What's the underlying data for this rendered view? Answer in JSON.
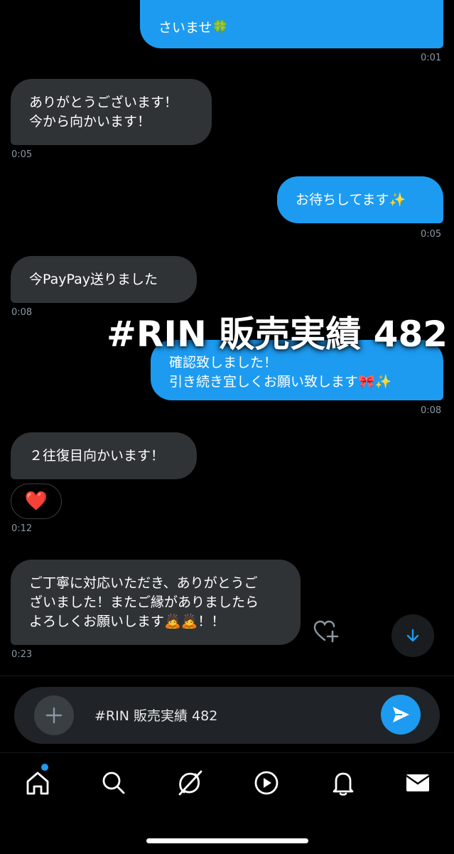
{
  "messages": [
    {
      "text": "さいませ🍀",
      "time": "0:01"
    },
    {
      "text": "ありがとうございます！\n今から向かいます！",
      "time": "0:05"
    },
    {
      "text": "お待ちしてます✨",
      "time": "0:05"
    },
    {
      "text": "今PayPay送りました",
      "time": "0:08"
    },
    {
      "text": "確認致しました！\n引き続き宜しくお願い致します🎀✨",
      "time": "0:08"
    },
    {
      "text": "２往復目向かいます！",
      "time": "0:12",
      "reaction": "❤️"
    },
    {
      "text": "ご丁寧に対応いただき、ありがとうご\nざいました！またご縁がありましたら\nよろしくお願いします🙇🙇！！",
      "time": "0:23"
    }
  ],
  "overlay_text": "#RIN 販売実績 482",
  "composer": {
    "value": "#RIN 販売実績 482"
  },
  "nav": {
    "items": [
      "home-icon",
      "search-icon",
      "grok-icon",
      "video-icon",
      "notifications-icon",
      "messages-icon"
    ]
  },
  "colors": {
    "accent": "#1d9bf0",
    "incoming_bubble": "#2f3336",
    "background": "#000000"
  }
}
